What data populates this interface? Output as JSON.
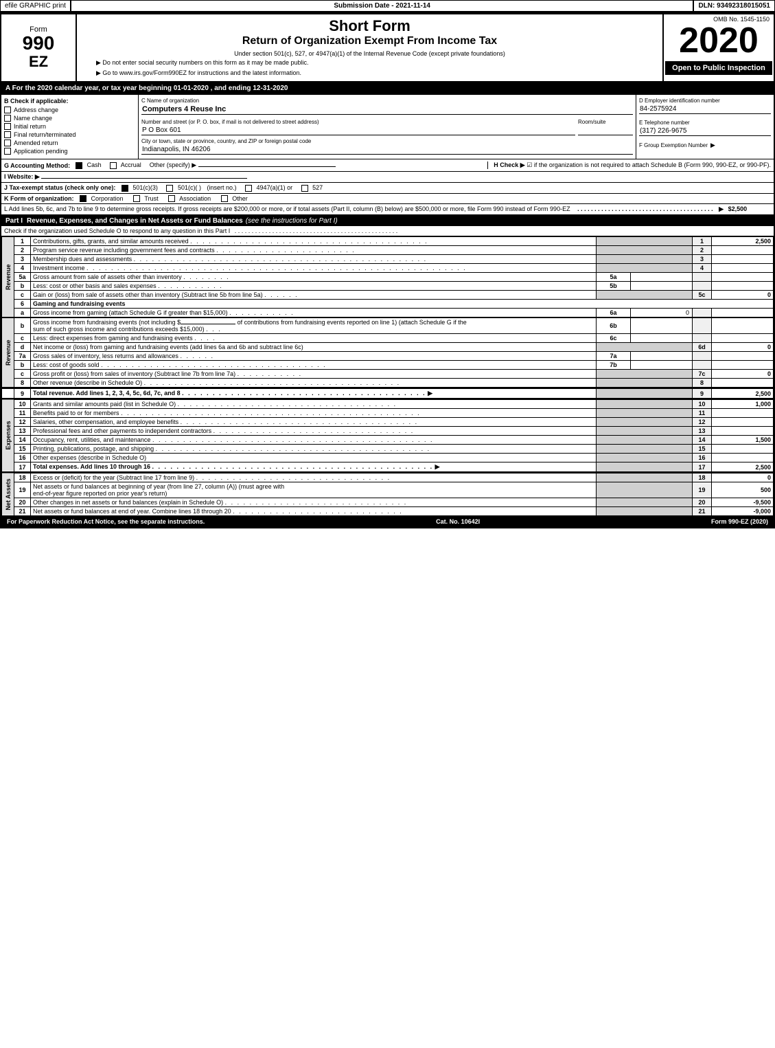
{
  "topbar": {
    "left": "efile GRAPHIC print",
    "mid": "Submission Date - 2021-11-14",
    "right": "DLN: 93492318015051"
  },
  "form": {
    "number": "990",
    "number_sub": "EZ",
    "title_main": "Short Form",
    "title_sub": "Return of Organization Exempt From Income Tax",
    "subtitle": "Under section 501(c), 527, or 4947(a)(1) of the Internal Revenue Code (except private foundations)",
    "instruction1": "▶ Do not enter social security numbers on this form as it may be made public.",
    "instruction2": "▶ Go to www.irs.gov/Form990EZ for instructions and the latest information.",
    "omb": "OMB No. 1545-1150",
    "year": "2020",
    "open_to_public": "Open to Public Inspection"
  },
  "calendar_row": "A For the 2020 calendar year, or tax year beginning 01-01-2020 , and ending 12-31-2020",
  "sections": {
    "b_label": "B  Check if applicable:",
    "b_checkboxes": [
      {
        "label": "Address change",
        "checked": false
      },
      {
        "label": "Name change",
        "checked": false
      },
      {
        "label": "Initial return",
        "checked": false
      },
      {
        "label": "Final return/terminated",
        "checked": false
      },
      {
        "label": "Amended return",
        "checked": false
      },
      {
        "label": "Application pending",
        "checked": false
      }
    ],
    "c_label": "C Name of organization",
    "c_value": "Computers 4 Reuse Inc",
    "address_label": "Number and street (or P. O. box, if mail is not delivered to street address)",
    "address_value": "P O Box 601",
    "room_label": "Room/suite",
    "room_value": "",
    "city_label": "City or town, state or province, country, and ZIP or foreign postal code",
    "city_value": "Indianapolis, IN  46206",
    "d_label": "D Employer identification number",
    "d_value": "84-2575924",
    "e_label": "E Telephone number",
    "e_value": "(317) 226-9675",
    "f_label": "F Group Exemption Number",
    "f_value": "",
    "g_label": "G Accounting Method:",
    "g_cash": "Cash",
    "g_cash_checked": true,
    "g_accrual": "Accrual",
    "g_accrual_checked": false,
    "g_other": "Other (specify) ▶",
    "g_other_value": "",
    "h_label": "H  Check ▶",
    "h_text": "☑ if the organization is not required to attach Schedule B (Form 990, 990-EZ, or 990-PF).",
    "i_label": "I Website: ▶",
    "j_label": "J Tax-exempt status (check only one):",
    "j_501c3": "501(c)(3)",
    "j_501c3_checked": true,
    "j_501c": "501(c)(  )",
    "j_501c_checked": false,
    "j_insert": "(insert no.)",
    "j_4947": "4947(a)(1) or",
    "j_4947_checked": false,
    "j_527": "527",
    "j_527_checked": false,
    "k_label": "K Form of organization:",
    "k_corp": "Corporation",
    "k_corp_checked": true,
    "k_trust": "Trust",
    "k_trust_checked": false,
    "k_assoc": "Association",
    "k_assoc_checked": false,
    "k_other": "Other",
    "k_other_checked": false,
    "l_text": "L Add lines 5b, 6c, and 7b to line 9 to determine gross receipts. If gross receipts are $200,000 or more, or if total assets (Part II, column (B) below) are $500,000 or more, file Form 990 instead of Form 990-EZ",
    "l_amount": "$2,500"
  },
  "part1": {
    "header": "Part I",
    "title": "Revenue, Expenses, and Changes in Net Assets or Fund Balances",
    "title_note": "(see the instructions for Part I)",
    "check_text": "Check if the organization used Schedule O to respond to any question in this Part I",
    "rows": [
      {
        "num": "1",
        "desc": "Contributions, gifts, grants, and similar amounts received",
        "dots": true,
        "lineno": "1",
        "value": "2,500"
      },
      {
        "num": "2",
        "desc": "Program service revenue including government fees and contracts",
        "dots": true,
        "lineno": "2",
        "value": ""
      },
      {
        "num": "3",
        "desc": "Membership dues and assessments",
        "dots": true,
        "lineno": "3",
        "value": ""
      },
      {
        "num": "4",
        "desc": "Investment income",
        "dots": true,
        "lineno": "4",
        "value": ""
      },
      {
        "num": "5a",
        "desc": "Gross amount from sale of assets other than inventory",
        "dots": true,
        "sub_lineno": "5a",
        "sub_value": "",
        "lineno": "",
        "value": ""
      },
      {
        "num": "b",
        "desc": "Less: cost or other basis and sales expenses",
        "dots": true,
        "sub_lineno": "5b",
        "sub_value": "",
        "lineno": "",
        "value": ""
      },
      {
        "num": "c",
        "desc": "Gain or (loss) from sale of assets other than inventory (Subtract line 5b from line 5a)",
        "dots": true,
        "lineno": "5c",
        "value": "0"
      },
      {
        "num": "6",
        "desc": "Gaming and fundraising events",
        "dots": false,
        "lineno": "",
        "value": ""
      },
      {
        "num": "a",
        "desc": "Gross income from gaming (attach Schedule G if greater than $15,000)",
        "sub_lineno": "6a",
        "sub_value": "0",
        "dots": true,
        "lineno": "",
        "value": ""
      },
      {
        "num": "b",
        "desc": "Gross income from fundraising events (not including $_____ of contributions from fundraising events reported on line 1) (attach Schedule G if the sum of such gross income and contributions exceeds $15,000)",
        "sub_lineno": "6b",
        "sub_value": "",
        "dots": false,
        "lineno": "",
        "value": ""
      },
      {
        "num": "c",
        "desc": "Less: direct expenses from gaming and fundraising events",
        "sub_lineno": "6c",
        "sub_value": "",
        "dots": true,
        "lineno": "",
        "value": ""
      },
      {
        "num": "d",
        "desc": "Net income or (loss) from gaming and fundraising events (add lines 6a and 6b and subtract line 6c)",
        "dots": false,
        "lineno": "6d",
        "value": "0"
      },
      {
        "num": "7a",
        "desc": "Gross sales of inventory, less returns and allowances",
        "sub_lineno": "7a",
        "sub_value": "",
        "dots": true,
        "lineno": "",
        "value": ""
      },
      {
        "num": "b",
        "desc": "Less: cost of goods sold",
        "sub_lineno": "7b",
        "sub_value": "",
        "dots": true,
        "lineno": "",
        "value": ""
      },
      {
        "num": "c",
        "desc": "Gross profit or (loss) from sales of inventory (Subtract line 7b from line 7a)",
        "dots": true,
        "lineno": "7c",
        "value": "0"
      },
      {
        "num": "8",
        "desc": "Other revenue (describe in Schedule O)",
        "dots": true,
        "lineno": "8",
        "value": ""
      },
      {
        "num": "9",
        "desc": "Total revenue. Add lines 1, 2, 3, 4, 5c, 6d, 7c, and 8",
        "bold": true,
        "dots": true,
        "arrow": true,
        "lineno": "9",
        "value": "2,500"
      }
    ],
    "expenses_rows": [
      {
        "num": "10",
        "desc": "Grants and similar amounts paid (list in Schedule O)",
        "dots": true,
        "lineno": "10",
        "value": "1,000"
      },
      {
        "num": "11",
        "desc": "Benefits paid to or for members",
        "dots": true,
        "lineno": "11",
        "value": ""
      },
      {
        "num": "12",
        "desc": "Salaries, other compensation, and employee benefits",
        "dots": true,
        "lineno": "12",
        "value": ""
      },
      {
        "num": "13",
        "desc": "Professional fees and other payments to independent contractors",
        "dots": true,
        "lineno": "13",
        "value": ""
      },
      {
        "num": "14",
        "desc": "Occupancy, rent, utilities, and maintenance",
        "dots": true,
        "lineno": "14",
        "value": "1,500"
      },
      {
        "num": "15",
        "desc": "Printing, publications, postage, and shipping",
        "dots": true,
        "lineno": "15",
        "value": ""
      },
      {
        "num": "16",
        "desc": "Other expenses (describe in Schedule O)",
        "dots": false,
        "lineno": "16",
        "value": ""
      },
      {
        "num": "17",
        "desc": "Total expenses. Add lines 10 through 16",
        "bold": true,
        "dots": true,
        "arrow": true,
        "lineno": "17",
        "value": "2,500"
      }
    ],
    "net_assets_rows": [
      {
        "num": "18",
        "desc": "Excess or (deficit) for the year (Subtract line 17 from line 9)",
        "dots": true,
        "lineno": "18",
        "value": "0"
      },
      {
        "num": "19",
        "desc": "Net assets or fund balances at beginning of year (from line 27, column (A)) (must agree with end-of-year figure reported on prior year's return)",
        "dots": false,
        "lineno": "19",
        "value": "500"
      },
      {
        "num": "20",
        "desc": "Other changes in net assets or fund balances (explain in Schedule O)",
        "dots": true,
        "lineno": "20",
        "value": "-9,500"
      },
      {
        "num": "21",
        "desc": "Net assets or fund balances at end of year. Combine lines 18 through 20",
        "dots": true,
        "lineno": "21",
        "value": "-9,000"
      }
    ]
  },
  "footer": {
    "left": "For Paperwork Reduction Act Notice, see the separate instructions.",
    "mid": "Cat. No. 10642I",
    "right": "Form 990-EZ (2020)"
  }
}
